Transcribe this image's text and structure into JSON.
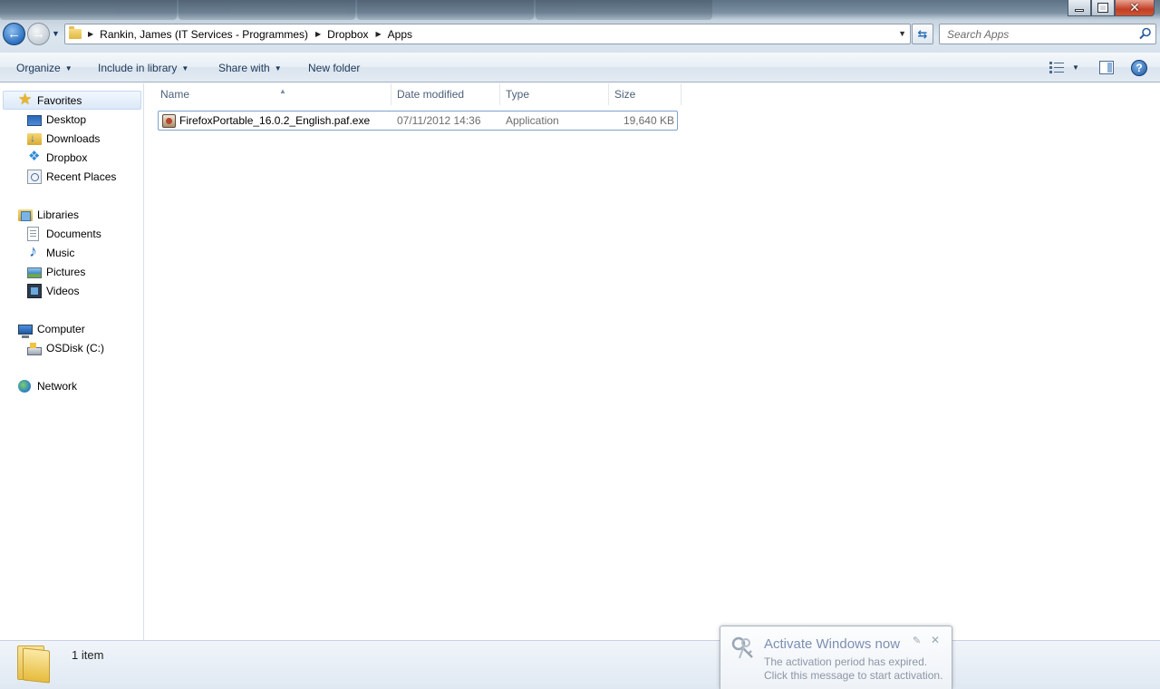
{
  "window": {
    "minimize_glyph": "",
    "restore_glyph": "",
    "close_glyph": "✕"
  },
  "address": {
    "breadcrumbs": [
      "Rankin, James (IT Services - Programmes)",
      "Dropbox",
      "Apps"
    ]
  },
  "search": {
    "placeholder": "Search Apps"
  },
  "toolbar": {
    "organize": "Organize",
    "include_in_library": "Include in library",
    "share_with": "Share with",
    "new_folder": "New folder"
  },
  "navigation": {
    "favorites": {
      "label": "Favorites",
      "items": [
        "Desktop",
        "Downloads",
        "Dropbox",
        "Recent Places"
      ]
    },
    "libraries": {
      "label": "Libraries",
      "items": [
        "Documents",
        "Music",
        "Pictures",
        "Videos"
      ]
    },
    "computer": {
      "label": "Computer",
      "items": [
        "OSDisk (C:)"
      ]
    },
    "network": {
      "label": "Network"
    }
  },
  "file_list": {
    "columns": [
      "Name",
      "Date modified",
      "Type",
      "Size"
    ],
    "files": [
      {
        "name": "FirefoxPortable_16.0.2_English.paf.exe",
        "date_modified": "07/11/2012 14:36",
        "type": "Application",
        "size": "19,640 KB"
      }
    ]
  },
  "status_bar": {
    "item_count": "1 item"
  },
  "activation": {
    "title": "Activate Windows now",
    "line1": "The activation period has expired.",
    "line2": "Click this message to start activation."
  },
  "colors": {
    "accent": "#2a6fc0",
    "selection_border": "#7da2ce",
    "header_text": "#4c607a"
  }
}
